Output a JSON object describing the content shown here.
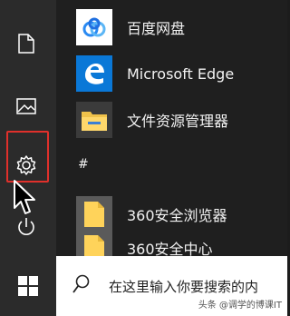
{
  "apps": [
    {
      "label": "百度网盘",
      "icon": "baidu-netdisk-icon",
      "tile_color": "#ffffff"
    },
    {
      "label": "Microsoft Edge",
      "icon": "edge-icon",
      "tile_color": "#0a78d7"
    },
    {
      "label": "文件资源管理器",
      "icon": "folder-icon",
      "tile_color": "#ffd35a"
    }
  ],
  "section_header": "#",
  "apps_360": [
    {
      "label": "360安全浏览器",
      "icon": "file-icon",
      "tile_color": "#ffd35a"
    },
    {
      "label": "360安全中心",
      "icon": "file-icon",
      "tile_color": "#ffd35a"
    }
  ],
  "search": {
    "placeholder": "在这里输入你要搜索的内"
  },
  "watermark": "头条 @调学的博课IT",
  "rail_icons": [
    "document-icon",
    "pictures-icon",
    "settings-icon",
    "power-icon"
  ],
  "colors": {
    "highlight": "#e0302b",
    "edge_blue": "#0a78d7"
  }
}
